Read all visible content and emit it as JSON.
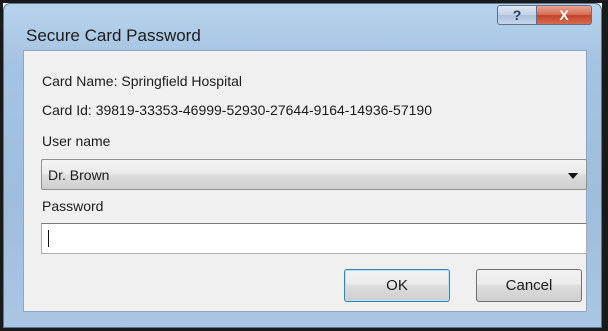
{
  "window": {
    "title": "Secure Card Password",
    "help_button_label": "?",
    "close_button_label": "X"
  },
  "card": {
    "name_line": "Card Name: Springfield Hospital",
    "id_line": "Card Id: 39819-33353-46999-52930-27644-9164-14936-57190"
  },
  "user": {
    "label": "User name",
    "selected": "Dr. Brown"
  },
  "password": {
    "label": "Password",
    "value": ""
  },
  "buttons": {
    "ok": "OK",
    "cancel": "Cancel"
  },
  "colors": {
    "titlebar": "#a5c3e2",
    "close_button": "#c4442a",
    "client_background": "#f0f0f0"
  },
  "icons": {
    "help": "help-icon",
    "close": "close-icon",
    "dropdown": "chevron-down-icon"
  }
}
